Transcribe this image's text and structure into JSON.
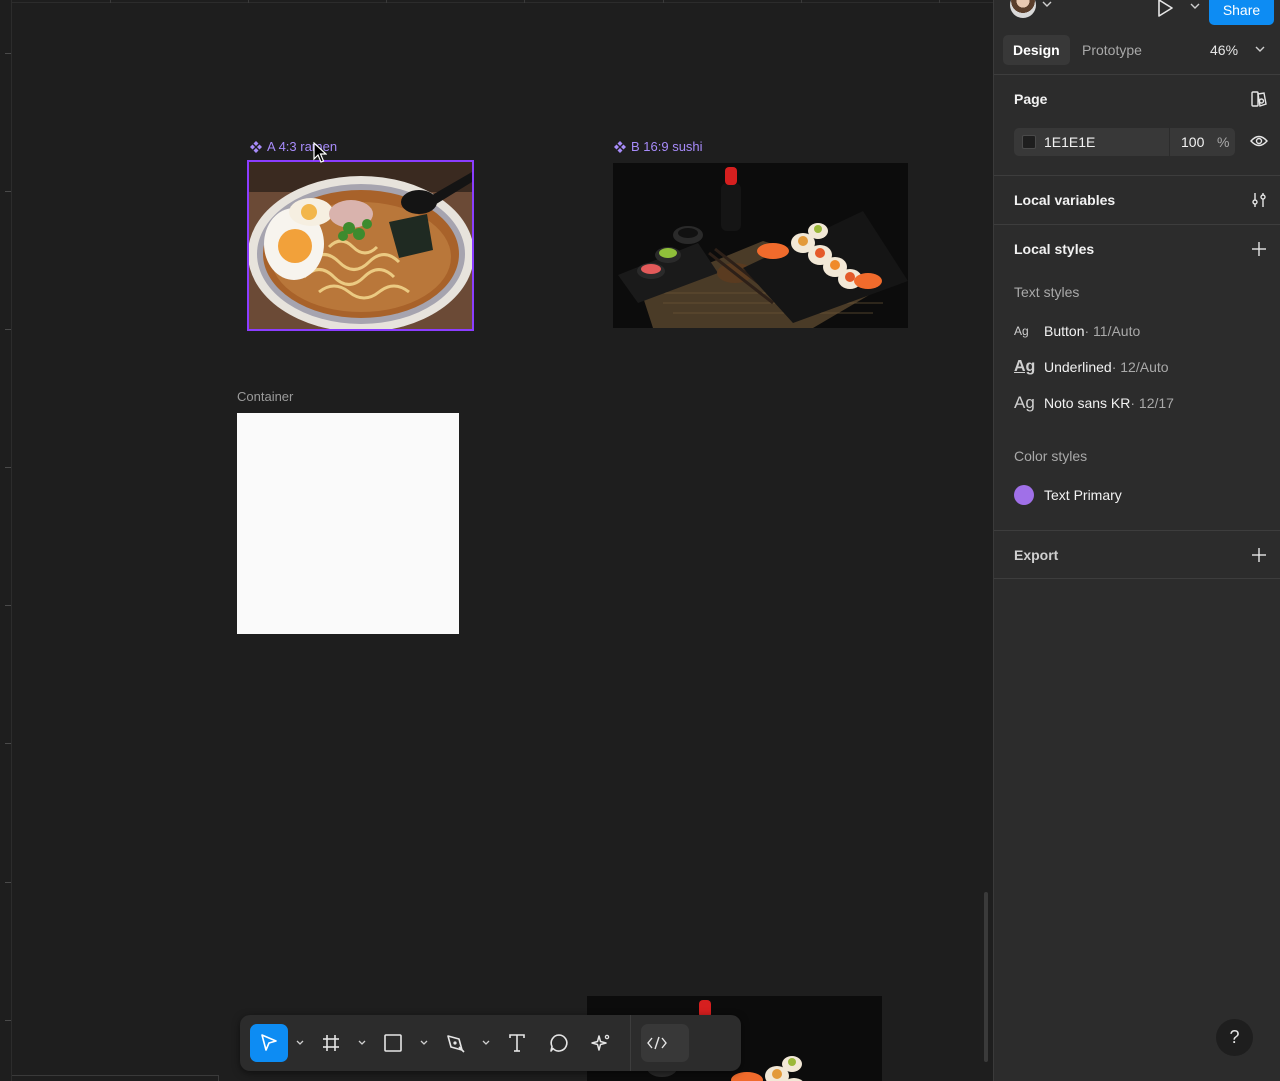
{
  "canvas": {
    "frames": [
      {
        "label": "A 4:3 ramen",
        "selected": true
      },
      {
        "label": "B 16:9 sushi",
        "selected": false
      }
    ],
    "container_label": "Container",
    "container_fill": "#FAFAFA"
  },
  "toolbar": {
    "tools": [
      {
        "name": "move",
        "icon": "cursor-arrow-icon",
        "active": true
      },
      {
        "name": "frame",
        "icon": "frame-hash-icon"
      },
      {
        "name": "shape",
        "icon": "rectangle-icon"
      },
      {
        "name": "pen",
        "icon": "pen-icon"
      },
      {
        "name": "text",
        "icon": "text-icon"
      },
      {
        "name": "comment",
        "icon": "comment-bubble-icon"
      },
      {
        "name": "actions",
        "icon": "sparkle-icon"
      },
      {
        "name": "dev-mode",
        "icon": "code-brackets-icon"
      }
    ]
  },
  "header": {
    "share_label": "Share"
  },
  "panel": {
    "tabs": {
      "design": "Design",
      "prototype": "Prototype"
    },
    "zoom": "46%",
    "page": {
      "title": "Page",
      "fill_hex": "1E1E1E",
      "opacity": "100",
      "opacity_unit": "%"
    },
    "local_variables": {
      "title": "Local variables"
    },
    "local_styles": {
      "title": "Local styles",
      "text_styles_title": "Text styles",
      "text_styles": [
        {
          "preview": "Ag",
          "name": "Button",
          "meta": " · 11/Auto"
        },
        {
          "preview": "Ag",
          "name": "Underlined",
          "meta": " · 12/Auto"
        },
        {
          "preview": "Ag",
          "name": "Noto sans KR",
          "meta": " · 12/17"
        }
      ],
      "color_styles_title": "Color styles",
      "color_styles": [
        {
          "name": "Text Primary",
          "color": "#A070E8"
        }
      ]
    },
    "export": {
      "title": "Export"
    },
    "help": "?"
  },
  "colors": {
    "accent": "#0D8CF3",
    "selection": "#8B3DFF",
    "component_label": "#A78BFA",
    "canvas_bg": "#1E1E1E",
    "panel_bg": "#2C2C2C"
  }
}
